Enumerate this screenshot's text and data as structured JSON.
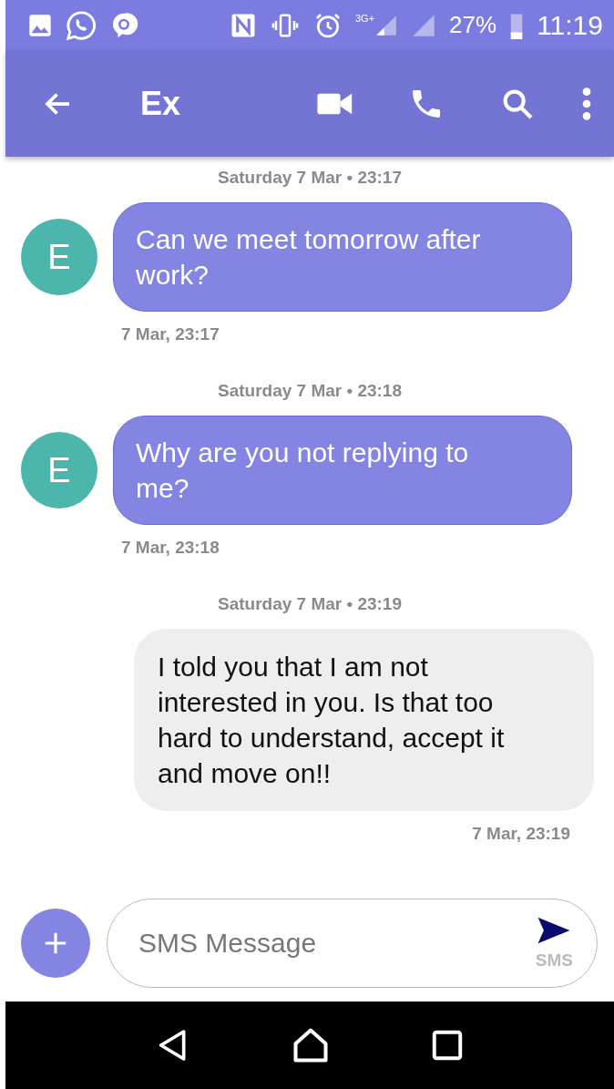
{
  "status_bar": {
    "network": "3G+",
    "battery": "27%",
    "time": "11:19"
  },
  "toolbar": {
    "title": "Ex"
  },
  "messages": [
    {
      "kind": "incoming",
      "date_header": "Saturday 7 Mar • 23:17",
      "avatar": "E",
      "text": "Can we meet tomorrow after work?",
      "time": "7 Mar, 23:17"
    },
    {
      "kind": "incoming",
      "date_header": "Saturday 7 Mar • 23:18",
      "avatar": "E",
      "text": "Why are you not replying to me?",
      "time": "7 Mar, 23:18"
    },
    {
      "kind": "outgoing",
      "date_header": "Saturday 7 Mar • 23:19",
      "text": "I told you that I am not interested in you. Is that too hard to understand, accept it and move on!!",
      "time": "7 Mar, 23:19"
    }
  ],
  "composer": {
    "placeholder": "SMS Message",
    "send_label": "SMS"
  }
}
